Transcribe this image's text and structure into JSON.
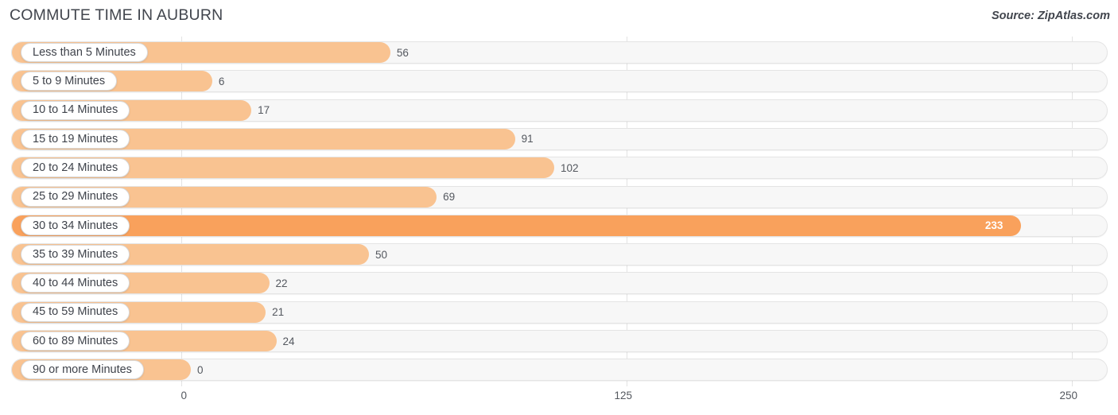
{
  "header": {
    "title": "COMMUTE TIME IN AUBURN",
    "source": "Source: ZipAtlas.com"
  },
  "colors": {
    "bar": "#f9c391",
    "bar_highlight": "#f9a15c",
    "track": "#f7f7f7",
    "track_border": "#e4e4e4",
    "gridline": "#e3e3e3",
    "text": "#3f434b"
  },
  "chart_data": {
    "type": "bar",
    "orientation": "horizontal",
    "title": "COMMUTE TIME IN AUBURN",
    "subtitle": "Source: ZipAtlas.com",
    "xlabel": "",
    "ylabel": "",
    "xlim": [
      0,
      250
    ],
    "xticks": [
      0,
      125,
      250
    ],
    "xtick_labels": [
      "0",
      "125",
      "250"
    ],
    "grid": true,
    "legend": "none",
    "categories": [
      "Less than 5 Minutes",
      "5 to 9 Minutes",
      "10 to 14 Minutes",
      "15 to 19 Minutes",
      "20 to 24 Minutes",
      "25 to 29 Minutes",
      "30 to 34 Minutes",
      "35 to 39 Minutes",
      "40 to 44 Minutes",
      "45 to 59 Minutes",
      "60 to 89 Minutes",
      "90 or more Minutes"
    ],
    "values": [
      56,
      6,
      17,
      91,
      102,
      69,
      233,
      50,
      22,
      21,
      24,
      0
    ],
    "value_labels": [
      "56",
      "6",
      "17",
      "91",
      "102",
      "69",
      "233",
      "50",
      "22",
      "21",
      "24",
      "0"
    ],
    "highlight_index": 6
  }
}
